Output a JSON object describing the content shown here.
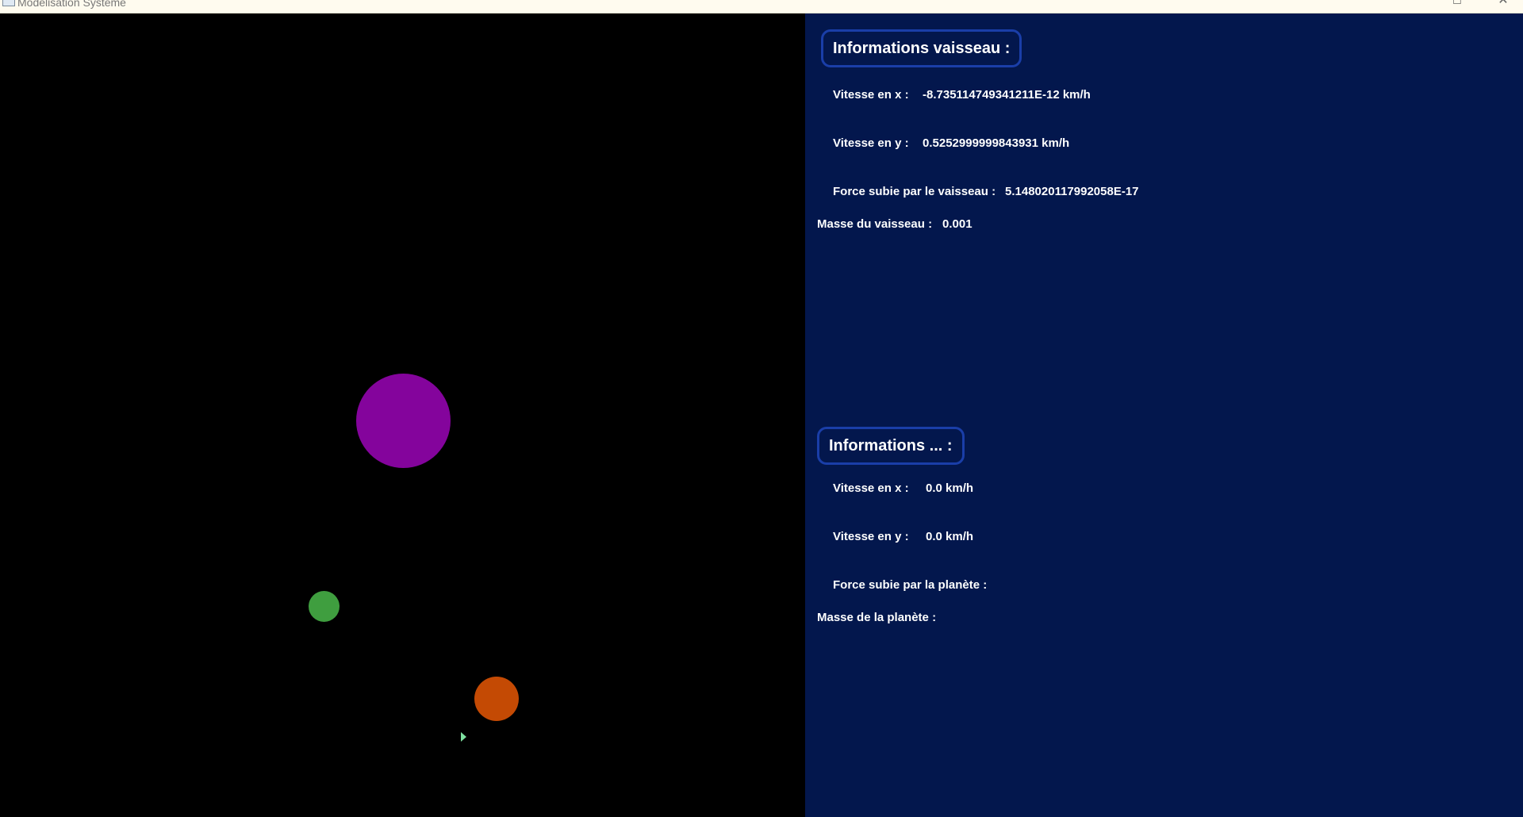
{
  "window": {
    "title": "Modélisation Système",
    "maximize_glyph": "☐",
    "close_glyph": "✕"
  },
  "simulation": {
    "bodies": [
      {
        "name": "planet-purple",
        "color": "#84049c"
      },
      {
        "name": "planet-green",
        "color": "#3f9e3f"
      },
      {
        "name": "planet-orange",
        "color": "#c44a04"
      }
    ],
    "ship_color": "#7ee0a0"
  },
  "ship_info": {
    "title": "Informations vaisseau :",
    "speed_x_label": "Vitesse en x :",
    "speed_x_value": "-8.735114749341211E-12 km/h",
    "speed_y_label": "Vitesse en y :",
    "speed_y_value": "0.5252999999843931 km/h",
    "force_label": "Force subie par le vaisseau :",
    "force_value": "5.148020117992058E-17",
    "mass_label": "Masse du vaisseau :",
    "mass_value": "0.001"
  },
  "planet_info": {
    "title": "Informations ... :",
    "speed_x_label": "Vitesse en x :",
    "speed_x_value": "0.0 km/h",
    "speed_y_label": "Vitesse en y :",
    "speed_y_value": "0.0 km/h",
    "force_label": "Force subie par la planète :",
    "force_value": "",
    "mass_label": "Masse de la planète :",
    "mass_value": ""
  },
  "colors": {
    "panel_background": "#03174d",
    "canvas_background": "#000000",
    "title_border": "#1a3ea8"
  }
}
